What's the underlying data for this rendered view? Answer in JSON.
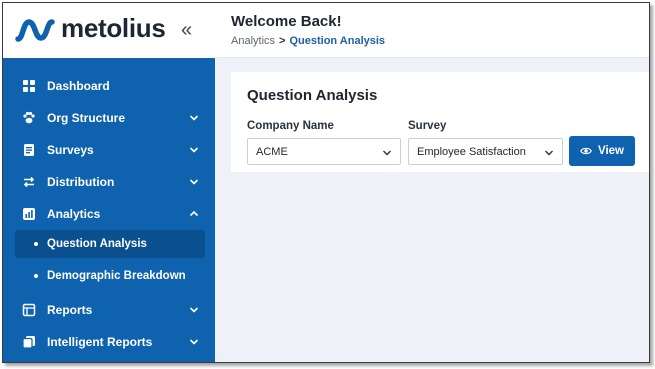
{
  "brand": {
    "name": "metolius",
    "collapse_glyph": "«",
    "logo_icon": "wave-logo",
    "logo_color": "#0e62ae"
  },
  "header": {
    "title": "Welcome Back!",
    "breadcrumb": {
      "parent": "Analytics",
      "separator": ">",
      "current": "Question Analysis"
    }
  },
  "sidebar": {
    "background": "#0e62ae",
    "items": [
      {
        "label": "Dashboard",
        "icon": "grid-icon"
      },
      {
        "label": "Org Structure",
        "icon": "paw-icon",
        "expandable": true
      },
      {
        "label": "Surveys",
        "icon": "document-icon",
        "expandable": true
      },
      {
        "label": "Distribution",
        "icon": "arrows-icon",
        "expandable": true
      },
      {
        "label": "Analytics",
        "icon": "chart-icon",
        "expanded": true,
        "children": [
          {
            "label": "Question Analysis",
            "active": true
          },
          {
            "label": "Demographic Breakdown"
          }
        ]
      },
      {
        "label": "Reports",
        "icon": "report-icon",
        "expandable": true
      },
      {
        "label": "Intelligent Reports",
        "icon": "stack-icon",
        "expandable": true
      }
    ]
  },
  "main": {
    "card_title": "Question Analysis",
    "company": {
      "label": "Company Name",
      "value": "ACME"
    },
    "survey": {
      "label": "Survey",
      "value": "Employee Satisfaction"
    },
    "view_button": {
      "label": "View",
      "icon": "eye-icon"
    }
  }
}
